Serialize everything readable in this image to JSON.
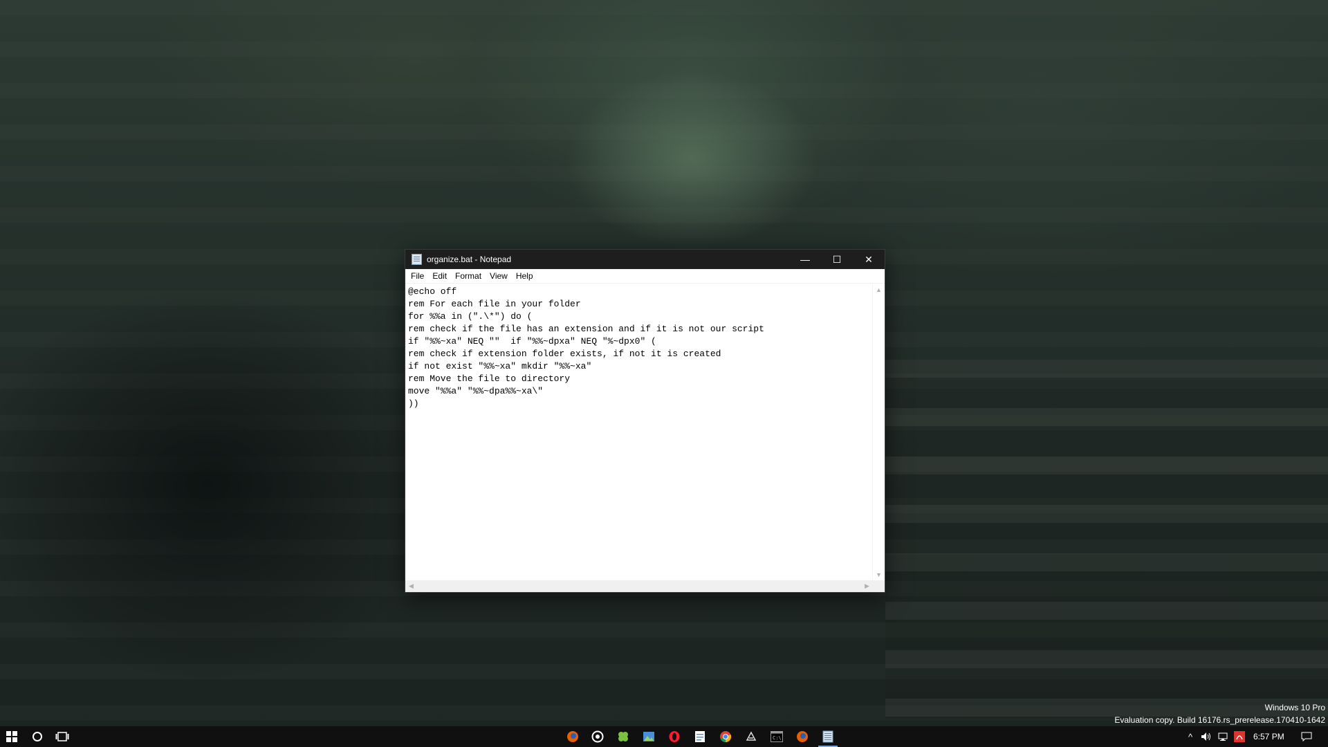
{
  "desktop": {
    "watermark_line1": "Windows 10 Pro",
    "watermark_line2": "Evaluation copy. Build 16176.rs_prerelease.170410-1642"
  },
  "notepad": {
    "title": "organize.bat - Notepad",
    "controls": {
      "minimize": "—",
      "maximize": "☐",
      "close": "✕"
    },
    "menu": [
      "File",
      "Edit",
      "Format",
      "View",
      "Help"
    ],
    "lines": [
      "@echo off",
      "rem For each file in your folder",
      "for %%a in (\".\\*\") do (",
      "rem check if the file has an extension and if it is not our script",
      "if \"%%~xa\" NEQ \"\"  if \"%%~dpxa\" NEQ \"%~dpx0\" (",
      "rem check if extension folder exists, if not it is created",
      "if not exist \"%%~xa\" mkdir \"%%~xa\"",
      "rem Move the file to directory",
      "move \"%%a\" \"%%~dpa%%~xa\\\"",
      "))"
    ]
  },
  "taskbar": {
    "start_icon": "windows-logo-icon",
    "search_icon": "cortana-circle-icon",
    "task_view_icon": "task-view-icon",
    "pinned_apps": [
      {
        "name": "firefox-icon",
        "color": "#e66000"
      },
      {
        "name": "chrome-like-circle-icon",
        "color": "#ffffff"
      },
      {
        "name": "clover-app-icon",
        "color": "#7ac043"
      },
      {
        "name": "image-viewer-icon",
        "color": "#4a8fd6"
      },
      {
        "name": "opera-icon",
        "color": "#ff1b2d"
      },
      {
        "name": "document-icon",
        "color": "#4a90e2"
      },
      {
        "name": "chrome-icon",
        "color": "#4285f4"
      },
      {
        "name": "inkscape-icon",
        "color": "#dddddd"
      },
      {
        "name": "command-prompt-icon",
        "color": "#9a9a9a"
      },
      {
        "name": "firefox-alt-icon",
        "color": "#e66000"
      },
      {
        "name": "notepad-icon",
        "color": "#cfe0f0"
      }
    ],
    "tray": {
      "show_hidden": "^",
      "clock": "6:57 PM"
    }
  },
  "colors": {
    "titlebar": "#1e1e1e",
    "taskbar": "#101010",
    "accent": "#7aa7e0"
  }
}
